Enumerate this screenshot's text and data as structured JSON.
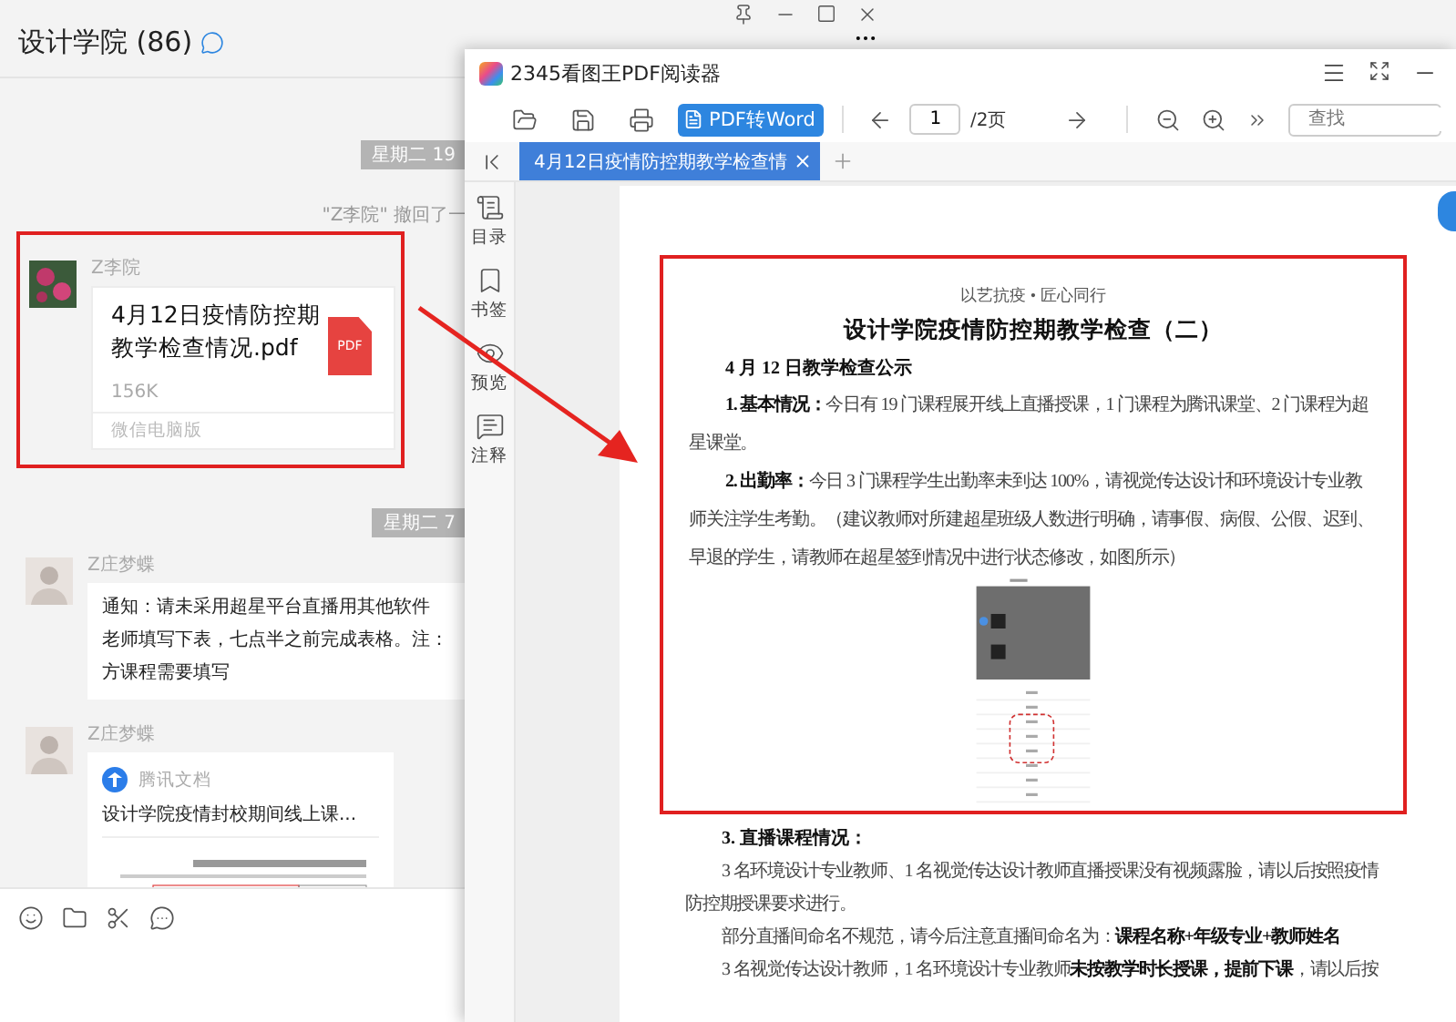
{
  "chat": {
    "title": "设计学院 (86)",
    "messages": [
      {
        "kind": "date",
        "text": "星期二 19"
      },
      {
        "kind": "notice",
        "text": "\"Z李院\" 撤回了一"
      },
      {
        "kind": "file",
        "sender": "Z李院",
        "highlighted": true,
        "file_name": "4月12日疫情防控期教学检查情况.pdf",
        "file_type": "PDF",
        "size": "156K",
        "source": "微信电脑版"
      },
      {
        "kind": "date",
        "text": "星期二 7"
      },
      {
        "kind": "text",
        "sender": "Z庄梦蝶",
        "lines": [
          "通知：请未采用超星平台直播用其他软件",
          "老师填写下表，七点半之前完成表格。注：",
          "方课程需要填写"
        ]
      },
      {
        "kind": "doc_link",
        "sender": "Z庄梦蝶",
        "app": "腾讯文档",
        "title": "设计学院疫情封校期间线上课..."
      }
    ]
  },
  "pdf_reader": {
    "title": "2345看图王PDF阅读器",
    "convert_button": "PDF转Word",
    "page_input": "1",
    "page_total": "/2页",
    "search_placeholder": "查找",
    "tabs": [
      {
        "label": "4月12日疫情防控期教学检查情",
        "selected": true
      }
    ],
    "side_panel": [
      {
        "kind": "contents",
        "label": "目录"
      },
      {
        "kind": "bookmark",
        "label": "书签"
      },
      {
        "kind": "preview",
        "label": "预览"
      },
      {
        "kind": "notes",
        "label": "注释"
      }
    ],
    "document": {
      "highlighted": true,
      "framed": [
        {
          "kind": "motto",
          "text": "以艺抗疫 • 匠心同行"
        },
        {
          "kind": "title",
          "text": "设计学院疫情防控期教学检查（二）"
        },
        {
          "kind": "heading",
          "text": "4 月 12 日教学检查公示"
        },
        {
          "kind": "para",
          "text": "**1. 基本情况：**今日有 19 门课程展开线上直播授课，1 门课程为腾讯课堂、2 门课程为超星课堂。"
        },
        {
          "kind": "para",
          "text": "**2. 出勤率：**今日 3 门课程学生出勤率未到达 100%，请视觉传达设计和环境设计专业教师关注学生考勤。（建议教师对所建超星班级人数进行明确，请事假、病假、公假、迟到、早退的学生，请教师在超星签到情况中进行状态修改，如图所示）"
        },
        {
          "kind": "figure"
        }
      ],
      "rest": [
        {
          "kind": "heading",
          "text": "3. 直播课程情况："
        },
        {
          "kind": "para",
          "text": "3 名环境设计专业教师、1 名视觉传达设计教师直播授课没有视频露脸，请以后按照疫情防控期授课要求进行。"
        },
        {
          "kind": "para",
          "text": "部分直播间命名不规范，请今后注意直播间命名为：**课程名称+年级专业+教师姓名**"
        },
        {
          "kind": "para",
          "text": "3 名视觉传达设计教师，1 名环境设计专业教师**未按教学时长授课，提前下课**，请以后按"
        }
      ]
    }
  }
}
